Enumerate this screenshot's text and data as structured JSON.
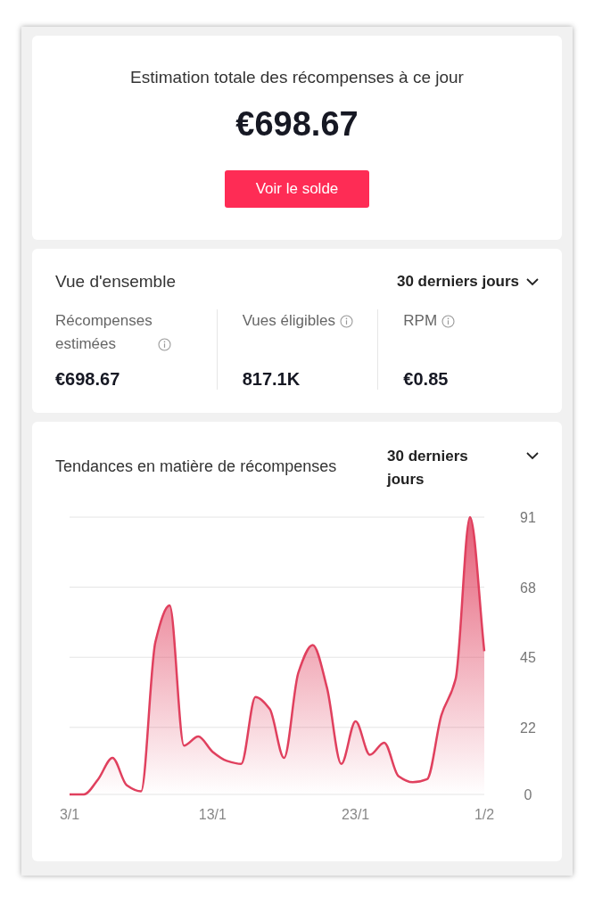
{
  "summary": {
    "title": "Estimation totale des récompenses à ce jour",
    "amount": "€698.67",
    "button": "Voir le solde"
  },
  "overview": {
    "title": "Vue d'ensemble",
    "period": "30 derniers jours",
    "metrics": [
      {
        "label": "Récompenses estimées",
        "value": "€698.67"
      },
      {
        "label": "Vues éligibles",
        "value": "817.1K"
      },
      {
        "label": "RPM",
        "value": "€0.85"
      }
    ]
  },
  "trends": {
    "title": "Tendances en matière de récompenses",
    "period": "30 derniers jours",
    "chart_data": {
      "type": "area",
      "grid": true,
      "categories": [
        "3/1",
        null,
        null,
        null,
        null,
        null,
        null,
        null,
        null,
        null,
        "13/1",
        null,
        null,
        null,
        null,
        null,
        null,
        null,
        null,
        null,
        "23/1",
        null,
        null,
        null,
        null,
        null,
        null,
        null,
        null,
        "1/2"
      ],
      "series": [
        {
          "color": "#e0405e",
          "values": [
            0,
            0,
            5,
            12,
            3,
            1,
            50,
            62,
            16,
            19,
            14,
            11,
            10,
            32,
            28,
            12,
            40,
            49,
            35,
            10,
            24,
            13,
            17,
            6,
            4,
            5,
            26,
            38,
            91,
            47
          ]
        }
      ],
      "ylim": [
        0,
        91
      ],
      "yticks": [
        0,
        22,
        45,
        68,
        91
      ]
    }
  }
}
